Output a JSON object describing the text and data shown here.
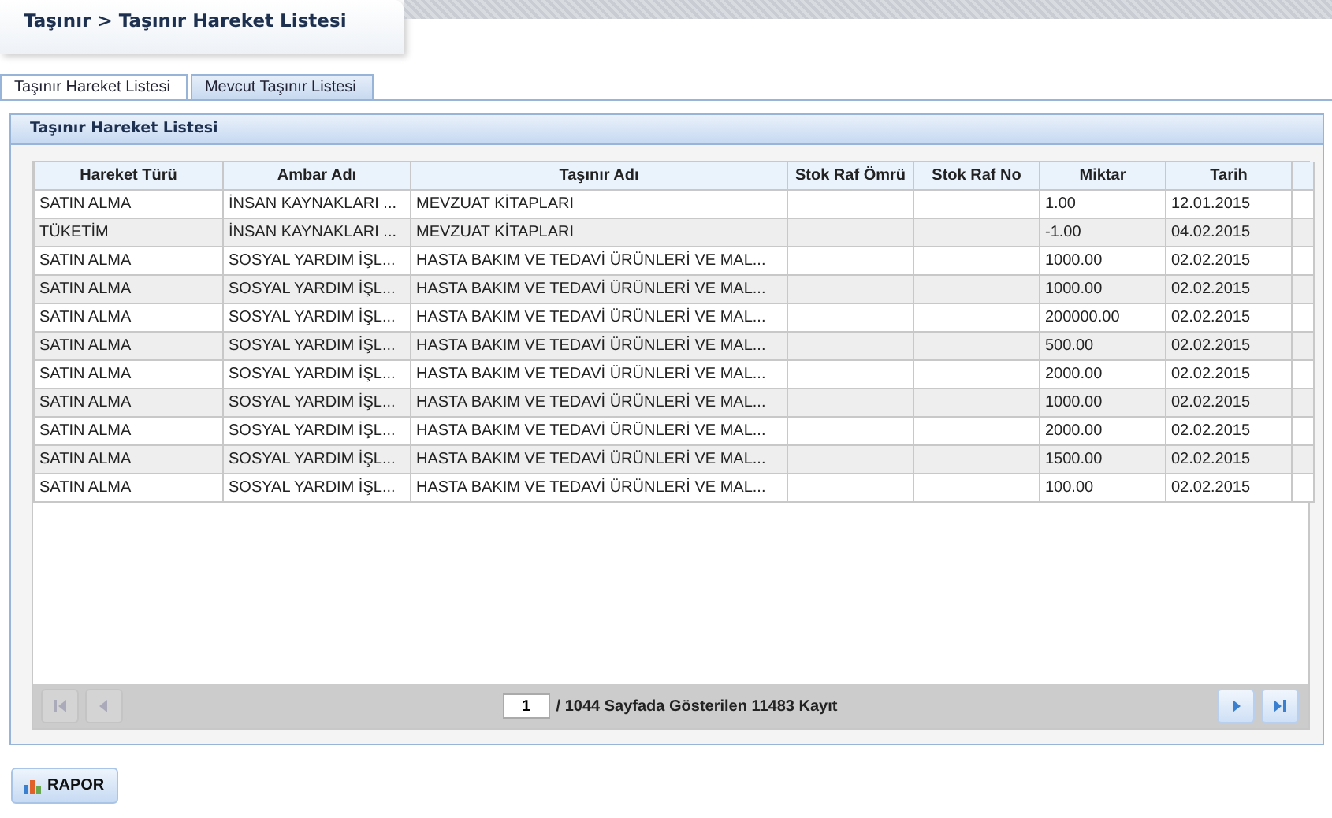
{
  "breadcrumb": "Taşınır > Taşınır Hareket Listesi",
  "tabs": [
    {
      "label": "Taşınır Hareket Listesi",
      "selected": true
    },
    {
      "label": "Mevcut Taşınır Listesi",
      "selected": false
    }
  ],
  "panel": {
    "title": "Taşınır Hareket Listesi"
  },
  "table": {
    "columns": [
      "Hareket Türü",
      "Ambar Adı",
      "Taşınır Adı",
      "Stok Raf Ömrü",
      "Stok Raf No",
      "Miktar",
      "Tarih"
    ],
    "rows": [
      [
        "SATIN ALMA",
        "İNSAN KAYNAKLARI ...",
        "MEVZUAT KİTAPLARI",
        "",
        "",
        "1.00",
        "12.01.2015"
      ],
      [
        "TÜKETİM",
        "İNSAN KAYNAKLARI ...",
        "MEVZUAT KİTAPLARI",
        "",
        "",
        "-1.00",
        "04.02.2015"
      ],
      [
        "SATIN ALMA",
        "SOSYAL YARDIM İŞL...",
        "HASTA BAKIM VE TEDAVİ ÜRÜNLERİ VE MAL...",
        "",
        "",
        "1000.00",
        "02.02.2015"
      ],
      [
        "SATIN ALMA",
        "SOSYAL YARDIM İŞL...",
        "HASTA BAKIM VE TEDAVİ ÜRÜNLERİ VE MAL...",
        "",
        "",
        "1000.00",
        "02.02.2015"
      ],
      [
        "SATIN ALMA",
        "SOSYAL YARDIM İŞL...",
        "HASTA BAKIM VE TEDAVİ ÜRÜNLERİ VE MAL...",
        "",
        "",
        "200000.00",
        "02.02.2015"
      ],
      [
        "SATIN ALMA",
        "SOSYAL YARDIM İŞL...",
        "HASTA BAKIM VE TEDAVİ ÜRÜNLERİ VE MAL...",
        "",
        "",
        "500.00",
        "02.02.2015"
      ],
      [
        "SATIN ALMA",
        "SOSYAL YARDIM İŞL...",
        "HASTA BAKIM VE TEDAVİ ÜRÜNLERİ VE MAL...",
        "",
        "",
        "2000.00",
        "02.02.2015"
      ],
      [
        "SATIN ALMA",
        "SOSYAL YARDIM İŞL...",
        "HASTA BAKIM VE TEDAVİ ÜRÜNLERİ VE MAL...",
        "",
        "",
        "1000.00",
        "02.02.2015"
      ],
      [
        "SATIN ALMA",
        "SOSYAL YARDIM İŞL...",
        "HASTA BAKIM VE TEDAVİ ÜRÜNLERİ VE MAL...",
        "",
        "",
        "2000.00",
        "02.02.2015"
      ],
      [
        "SATIN ALMA",
        "SOSYAL YARDIM İŞL...",
        "HASTA BAKIM VE TEDAVİ ÜRÜNLERİ VE MAL...",
        "",
        "",
        "1500.00",
        "02.02.2015"
      ],
      [
        "SATIN ALMA",
        "SOSYAL YARDIM İŞL...",
        "HASTA BAKIM VE TEDAVİ ÜRÜNLERİ VE MAL...",
        "",
        "",
        "100.00",
        "02.02.2015"
      ]
    ]
  },
  "pager": {
    "page": "1",
    "summary": "/ 1044 Sayfada Gösterilen 11483 Kayıt",
    "buttons": [
      {
        "kind": "first",
        "disabled": true
      },
      {
        "kind": "prev",
        "disabled": true
      },
      {
        "kind": "next",
        "disabled": false
      },
      {
        "kind": "last",
        "disabled": false
      }
    ]
  },
  "report_button": "RAPOR"
}
